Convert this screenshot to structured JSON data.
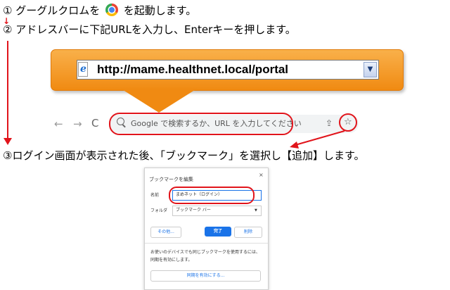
{
  "steps": {
    "s1_prefix": "① グーグルクロムを",
    "s1_suffix": "を起動します。",
    "s2": "② アドレスバーに下記URLを入力し、Enterキーを押します。",
    "s3": "③ログイン画面が表示された後、「ブックマーク」を選択し【追加】します。"
  },
  "ie_address": {
    "url": "http://mame.healthnet.local/portal",
    "icon": "ie-page-icon",
    "dropdown_glyph": "▼"
  },
  "chrome_toolbar": {
    "back_glyph": "←",
    "forward_glyph": "→",
    "reload_glyph": "C",
    "omnibox_placeholder": "Google で検索するか、URL を入力してください",
    "share_glyph": "⇪",
    "star_glyph": "☆"
  },
  "bookmark_dialog": {
    "title": "ブックマークを編集",
    "close_glyph": "×",
    "name_label": "名前",
    "name_value": "まめネット（ログイン）",
    "folder_label": "フォルダ",
    "folder_value": "ブックマーク バー",
    "folder_caret": "▼",
    "other_button": "その他...",
    "done_button": "完了",
    "delete_button": "削除",
    "sync_message_line1": "お使いのデバイスでも同じブックマークを使用するには、",
    "sync_message_line2": "同期を有効にします。",
    "sync_button": "同期を有効にする..."
  },
  "colors": {
    "annotation_red": "#e1141b",
    "callout_orange": "#f08a12",
    "chrome_blue": "#1a73e8"
  }
}
